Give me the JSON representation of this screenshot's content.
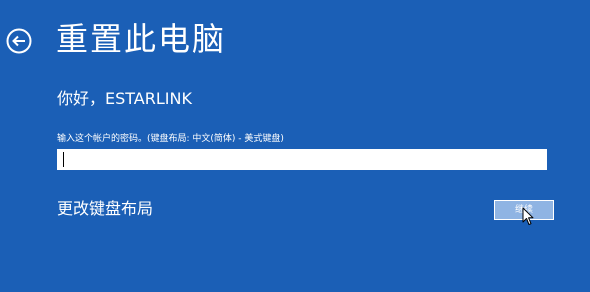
{
  "page": {
    "title": "重置此电脑",
    "back_icon": "back-arrow-icon"
  },
  "greeting": "你好，ESTARLINK",
  "password": {
    "label": "输入这个帐户的密码。(键盘布局: 中文(简体) - 美式键盘)",
    "value": ""
  },
  "change_keyboard_label": "更改键盘布局",
  "continue_label": "继续",
  "colors": {
    "background": "#1b5fb6",
    "text": "#ffffff",
    "button_fill": "#8fb4e3"
  }
}
